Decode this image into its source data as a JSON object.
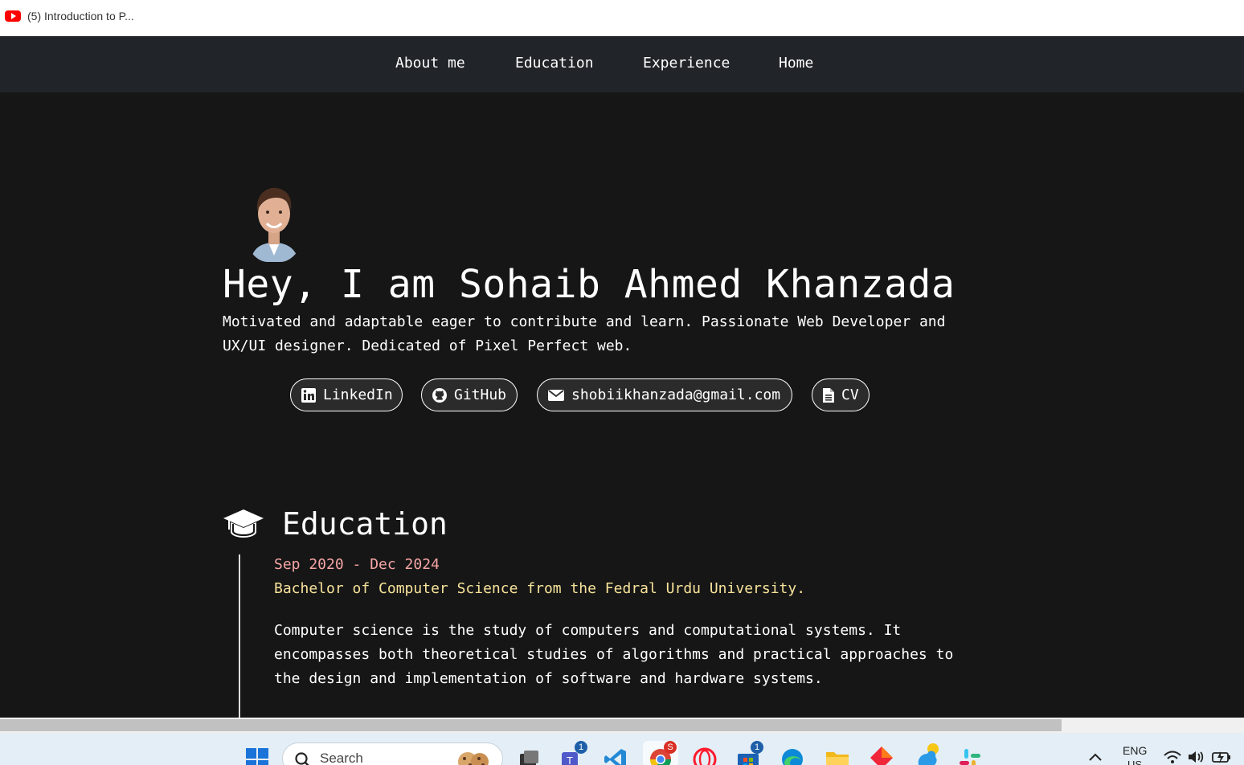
{
  "browser": {
    "tab_title": "(5) Introduction to P..."
  },
  "nav": {
    "about": "About me",
    "education": "Education",
    "experience": "Experience",
    "home": "Home"
  },
  "hero": {
    "title": "Hey, I am Sohaib Ahmed Khanzada",
    "subtitle": "Motivated and adaptable eager to contribute and learn. Passionate Web Developer and UX/UI designer. Dedicated of Pixel Perfect web."
  },
  "links": {
    "linkedin": "LinkedIn",
    "github": "GitHub",
    "email": "shobiikhanzada@gmail.com",
    "cv": "CV"
  },
  "education": {
    "heading": "Education",
    "date": "Sep 2020 - Dec 2024",
    "degree": "Bachelor of Computer Science from the Fedral Urdu University.",
    "description": "Computer science is the study of computers and computational systems. It encompasses both theoretical studies of algorithms and practical approaches to the design and implementation of software and hardware systems."
  },
  "taskbar": {
    "search_label": "Search",
    "teams_badge": "1",
    "store_badge": "1",
    "chrome_badge": "S",
    "language": "ENG",
    "region": "US"
  },
  "colors": {
    "background": "#161616",
    "navbar": "#212429",
    "date": "#f6a5a5",
    "degree": "#f7e39a"
  }
}
